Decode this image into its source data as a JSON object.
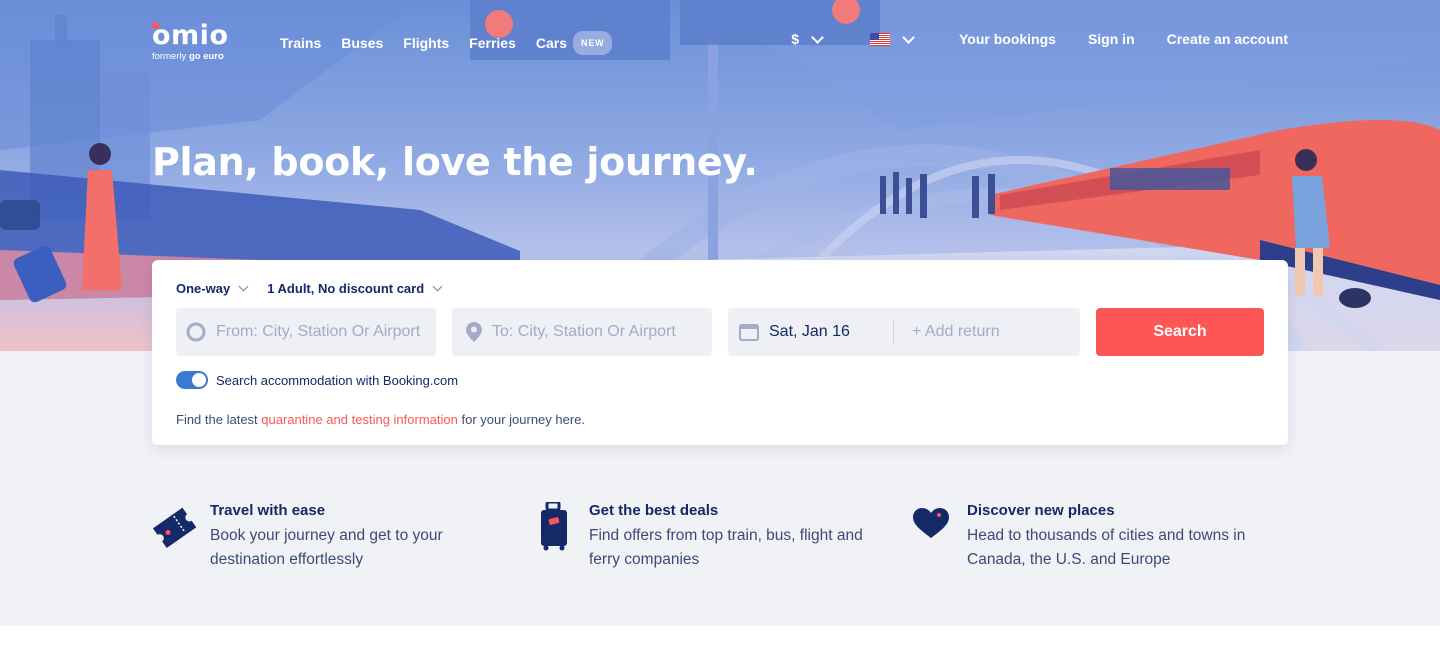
{
  "colors": {
    "accent": "#fc5656",
    "brand_navy": "#132968",
    "toggle_on": "#3a7ad0",
    "page_bg": "#f1f2f6"
  },
  "logo": {
    "word": "omio",
    "tagline_prefix": "formerly",
    "tagline_brand": "go euro"
  },
  "nav": {
    "links": [
      "Trains",
      "Buses",
      "Flights",
      "Ferries",
      "Cars"
    ],
    "new_badge": "NEW",
    "currency": "$",
    "language_flag": "us-flag-icon",
    "right_links": [
      "Your bookings",
      "Sign in",
      "Create an account"
    ]
  },
  "hero": {
    "headline": "Plan, book, love the journey."
  },
  "search": {
    "trip_type": "One-way",
    "passengers": "1 Adult, No discount card",
    "from_placeholder": "From: City, Station Or Airport",
    "to_placeholder": "To: City, Station Or Airport",
    "depart_date": "Sat, Jan 16",
    "add_return": "+ Add return",
    "search_button": "Search",
    "accommodation_toggle_on": true,
    "accommodation_label": "Search accommodation with Booking.com",
    "info_prefix": "Find the latest ",
    "info_link": "quarantine and testing information",
    "info_suffix": " for your journey here."
  },
  "features": [
    {
      "icon": "ticket-icon",
      "title": "Travel with ease",
      "text": "Book your journey and get to your destination effortlessly"
    },
    {
      "icon": "suitcase-icon",
      "title": "Get the best deals",
      "text": "Find offers from top train, bus, flight and ferry companies"
    },
    {
      "icon": "heart-icon",
      "title": "Discover new places",
      "text": "Head to thousands of cities and towns in Canada, the U.S. and Europe"
    }
  ]
}
